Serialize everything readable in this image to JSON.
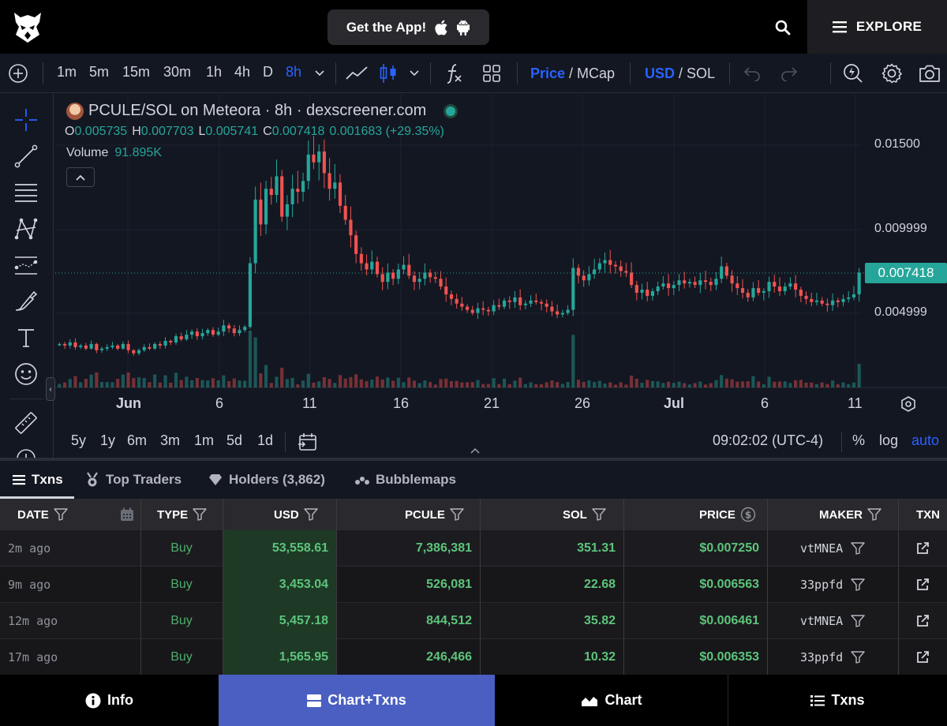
{
  "topbar": {
    "get_app_label": "Get the App!",
    "explore_label": "EXPLORE"
  },
  "toolbar": {
    "timeframes": [
      "1m",
      "5m",
      "15m",
      "30m",
      "1h",
      "4h",
      "D",
      "8h"
    ],
    "active_timeframe": "8h",
    "price_label": "Price",
    "mcap_label": "/ MCap",
    "usd_label": "USD",
    "sol_label": "/ SOL"
  },
  "chart": {
    "pair_title": "PCULE/SOL on Meteora · 8h · dexscreener.com",
    "ohlc": {
      "o_label": "O",
      "o_value": "0.005735",
      "h_label": "H",
      "h_value": "0.007703",
      "l_label": "L",
      "l_value": "0.005741",
      "c_label": "C",
      "c_value": "0.007418",
      "change": "0.001683 (+29.35%)"
    },
    "volume_label": "Volume",
    "volume_value": "91.895K",
    "current_price_label": "0.007418",
    "timezone": "09:02:02 (UTC-4)",
    "ranges": [
      "5y",
      "1y",
      "6m",
      "3m",
      "1m",
      "5d",
      "1d"
    ],
    "percent_label": "%",
    "log_label": "log",
    "auto_label": "auto"
  },
  "chart_data": {
    "type": "candlestick",
    "y_ticks": [
      "0.01500",
      "0.009999",
      "0.004999"
    ],
    "x_ticks": [
      "Jun",
      "6",
      "11",
      "16",
      "21",
      "26",
      "Jul",
      "6",
      "11"
    ],
    "current_price": 0.007418,
    "ylim": [
      0,
      0.0185
    ],
    "closes": [
      0.0028,
      0.0027,
      0.0029,
      0.0026,
      0.0027,
      0.0025,
      0.0028,
      0.0024,
      0.0025,
      0.0026,
      0.0027,
      0.0025,
      0.0028,
      0.0024,
      0.0022,
      0.0024,
      0.0026,
      0.0025,
      0.0028,
      0.0027,
      0.003,
      0.0029,
      0.0033,
      0.0031,
      0.0034,
      0.0036,
      0.0033,
      0.0035,
      0.0037,
      0.0034,
      0.0036,
      0.004,
      0.0038,
      0.0035,
      0.0037,
      0.0039,
      0.008,
      0.0121,
      0.0105,
      0.0128,
      0.0124,
      0.0136,
      0.011,
      0.0118,
      0.0128,
      0.0126,
      0.0133,
      0.015,
      0.0145,
      0.0152,
      0.0138,
      0.0128,
      0.0132,
      0.0117,
      0.0108,
      0.0098,
      0.0086,
      0.008,
      0.0076,
      0.0081,
      0.0073,
      0.0068,
      0.0074,
      0.007,
      0.0076,
      0.0079,
      0.0072,
      0.0068,
      0.007,
      0.0074,
      0.0071,
      0.007,
      0.0065,
      0.006,
      0.0057,
      0.0054,
      0.0052,
      0.005,
      0.0048,
      0.0051,
      0.005,
      0.0049,
      0.0053,
      0.0052,
      0.0056,
      0.0055,
      0.0058,
      0.0053,
      0.0054,
      0.0056,
      0.0055,
      0.0054,
      0.0052,
      0.0049,
      0.0047,
      0.0048,
      0.005,
      0.0077,
      0.0072,
      0.0069,
      0.0073,
      0.0076,
      0.008,
      0.0082,
      0.0079,
      0.0078,
      0.0075,
      0.0074,
      0.0066,
      0.0061,
      0.0063,
      0.0059,
      0.0062,
      0.0065,
      0.0067,
      0.0064,
      0.0066,
      0.0069,
      0.0067,
      0.0068,
      0.0066,
      0.0069,
      0.0068,
      0.0066,
      0.007,
      0.0078,
      0.0072,
      0.0067,
      0.0064,
      0.0061,
      0.0058,
      0.0064,
      0.0061,
      0.0062,
      0.0068,
      0.0065,
      0.0062,
      0.0065,
      0.0067,
      0.0063,
      0.0059,
      0.0057,
      0.0055,
      0.0056,
      0.0054,
      0.0053,
      0.0056,
      0.0055,
      0.0057,
      0.0058,
      0.006,
      0.0074
    ]
  },
  "tabs": {
    "txns": "Txns",
    "top_traders": "Top Traders",
    "holders": "Holders (3,862)",
    "bubblemaps": "Bubblemaps"
  },
  "table": {
    "headers": [
      "DATE",
      "TYPE",
      "USD",
      "PCULE",
      "SOL",
      "PRICE",
      "MAKER",
      "TXN"
    ],
    "rows": [
      {
        "date": "2m ago",
        "type": "Buy",
        "usd": "53,558.61",
        "pcule": "7,386,381",
        "sol": "351.31",
        "price": "$0.007250",
        "maker": "vtMNEA"
      },
      {
        "date": "9m ago",
        "type": "Buy",
        "usd": "3,453.04",
        "pcule": "526,081",
        "sol": "22.68",
        "price": "$0.006563",
        "maker": "33ppfd"
      },
      {
        "date": "12m ago",
        "type": "Buy",
        "usd": "5,457.18",
        "pcule": "844,512",
        "sol": "35.82",
        "price": "$0.006461",
        "maker": "vtMNEA"
      },
      {
        "date": "17m ago",
        "type": "Buy",
        "usd": "1,565.95",
        "pcule": "246,466",
        "sol": "10.32",
        "price": "$0.006353",
        "maker": "33ppfd"
      }
    ]
  },
  "bottomnav": {
    "info": "Info",
    "chart_txns": "Chart+Txns",
    "chart": "Chart",
    "txns": "Txns"
  },
  "colors": {
    "up": "#26a69a",
    "down": "#ef5350",
    "accent": "#2962ff",
    "nav_active": "#4a5fc1"
  }
}
